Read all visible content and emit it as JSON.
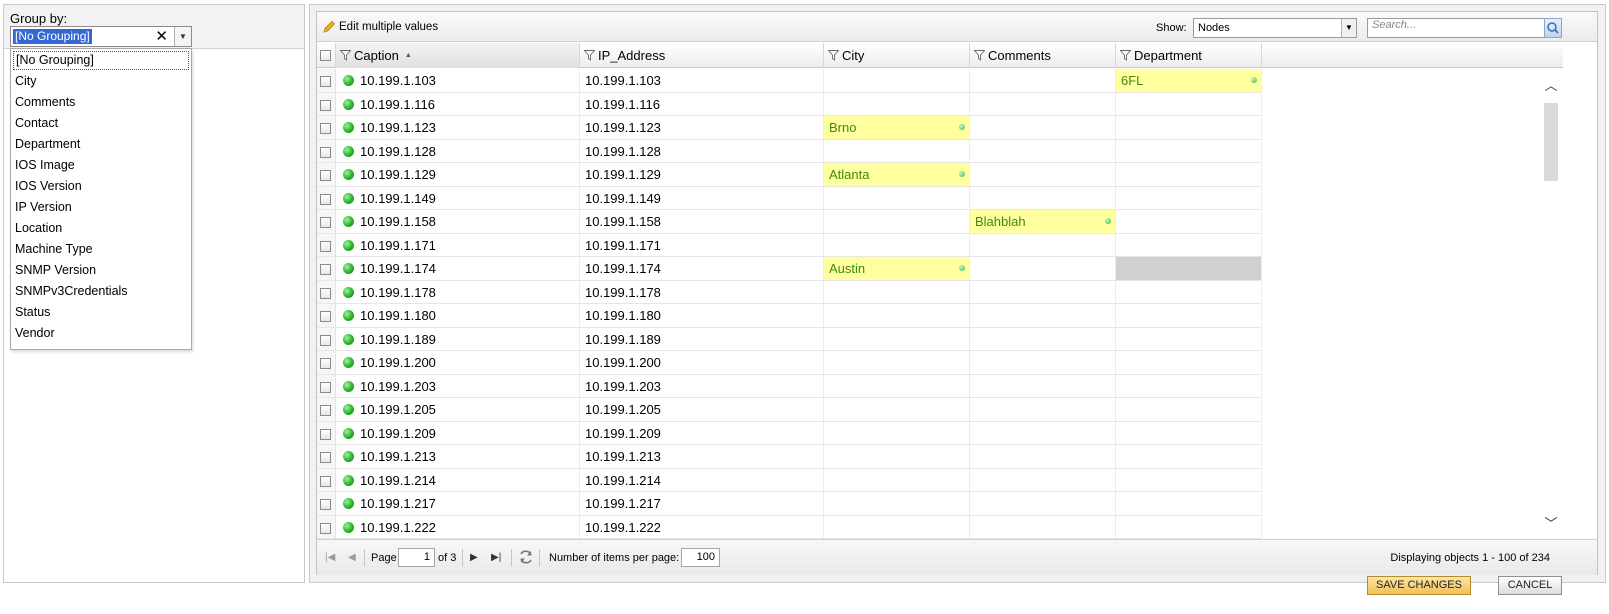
{
  "group_by": {
    "label": "Group by:",
    "selected": "[No Grouping]",
    "clear_glyph": "✕",
    "options": [
      "[No Grouping]",
      "City",
      "Comments",
      "Contact",
      "Department",
      "IOS Image",
      "IOS Version",
      "IP Version",
      "Location",
      "Machine Type",
      "SNMP Version",
      "SNMPv3Credentials",
      "Status",
      "Vendor"
    ]
  },
  "toolbar": {
    "edit_label": "Edit multiple values",
    "show_label": "Show:",
    "show_value": "Nodes",
    "search_placeholder": "Search..."
  },
  "columns": {
    "caption": "Caption",
    "ip": "IP_Address",
    "city": "City",
    "comments": "Comments",
    "department": "Department"
  },
  "rows": [
    {
      "caption": "10.199.1.103",
      "ip": "10.199.1.103",
      "city": "",
      "comments": "",
      "department": "6FL"
    },
    {
      "caption": "10.199.1.116",
      "ip": "10.199.1.116",
      "city": "",
      "comments": "",
      "department": ""
    },
    {
      "caption": "10.199.1.123",
      "ip": "10.199.1.123",
      "city": "Brno",
      "comments": "",
      "department": ""
    },
    {
      "caption": "10.199.1.128",
      "ip": "10.199.1.128",
      "city": "",
      "comments": "",
      "department": ""
    },
    {
      "caption": "10.199.1.129",
      "ip": "10.199.1.129",
      "city": "Atlanta",
      "comments": "",
      "department": ""
    },
    {
      "caption": "10.199.1.149",
      "ip": "10.199.1.149",
      "city": "",
      "comments": "",
      "department": ""
    },
    {
      "caption": "10.199.1.158",
      "ip": "10.199.1.158",
      "city": "",
      "comments": "Blahblah",
      "department": ""
    },
    {
      "caption": "10.199.1.171",
      "ip": "10.199.1.171",
      "city": "",
      "comments": "",
      "department": ""
    },
    {
      "caption": "10.199.1.174",
      "ip": "10.199.1.174",
      "city": "Austin",
      "comments": "",
      "department": ""
    },
    {
      "caption": "10.199.1.178",
      "ip": "10.199.1.178",
      "city": "",
      "comments": "",
      "department": ""
    },
    {
      "caption": "10.199.1.180",
      "ip": "10.199.1.180",
      "city": "",
      "comments": "",
      "department": ""
    },
    {
      "caption": "10.199.1.189",
      "ip": "10.199.1.189",
      "city": "",
      "comments": "",
      "department": ""
    },
    {
      "caption": "10.199.1.200",
      "ip": "10.199.1.200",
      "city": "",
      "comments": "",
      "department": ""
    },
    {
      "caption": "10.199.1.203",
      "ip": "10.199.1.203",
      "city": "",
      "comments": "",
      "department": ""
    },
    {
      "caption": "10.199.1.205",
      "ip": "10.199.1.205",
      "city": "",
      "comments": "",
      "department": ""
    },
    {
      "caption": "10.199.1.209",
      "ip": "10.199.1.209",
      "city": "",
      "comments": "",
      "department": ""
    },
    {
      "caption": "10.199.1.213",
      "ip": "10.199.1.213",
      "city": "",
      "comments": "",
      "department": ""
    },
    {
      "caption": "10.199.1.214",
      "ip": "10.199.1.214",
      "city": "",
      "comments": "",
      "department": ""
    },
    {
      "caption": "10.199.1.217",
      "ip": "10.199.1.217",
      "city": "",
      "comments": "",
      "department": ""
    },
    {
      "caption": "10.199.1.222",
      "ip": "10.199.1.222",
      "city": "",
      "comments": "",
      "department": ""
    }
  ],
  "pager": {
    "page_label": "Page",
    "page_value": "1",
    "of_label": "of 3",
    "items_label": "Number of items per page:",
    "items_value": "100",
    "display_text": "Displaying objects 1 - 100 of 234"
  },
  "actions": {
    "save_label": "SAVE CHANGES",
    "cancel_label": "CANCEL"
  },
  "colors": {
    "edited_bg": "#ffff9e",
    "edited_text": "#3d8b12",
    "status_up": "#27b327",
    "save_bg": "#f2bf55"
  }
}
